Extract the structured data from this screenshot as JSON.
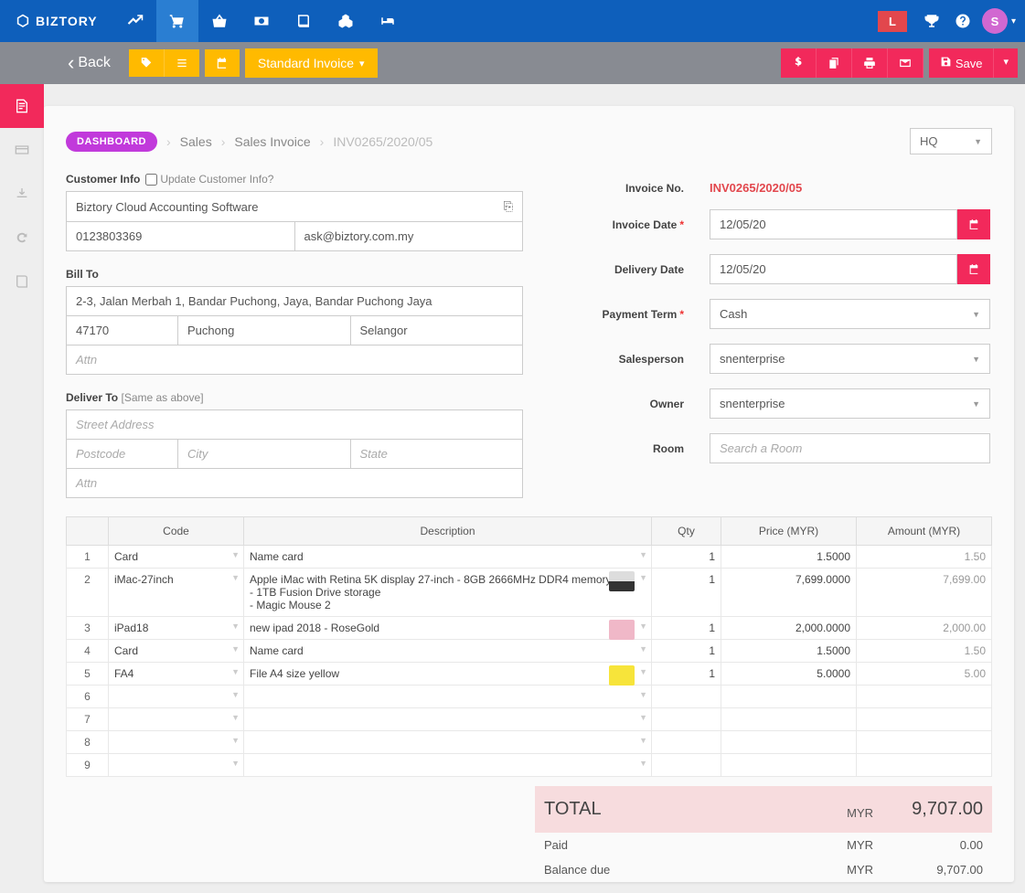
{
  "brand": "BIZTORY",
  "header": {
    "badge": "L",
    "avatar": "S"
  },
  "toolbar": {
    "back": "Back",
    "invoice_type": "Standard Invoice",
    "save": "Save"
  },
  "breadcrumb": {
    "dashboard": "DASHBOARD",
    "sales": "Sales",
    "sales_invoice": "Sales Invoice",
    "current": "INV0265/2020/05",
    "branch": "HQ"
  },
  "customer": {
    "label": "Customer Info",
    "update_label": "Update Customer Info?",
    "name": "Biztory Cloud Accounting Software",
    "phone": "0123803369",
    "email": "ask@biztory.com.my"
  },
  "bill_to": {
    "label": "Bill To",
    "street": "2-3, Jalan Merbah 1, Bandar Puchong, Jaya, Bandar Puchong Jaya",
    "postcode": "47170",
    "city": "Puchong",
    "state": "Selangor",
    "attn_placeholder": "Attn"
  },
  "deliver_to": {
    "label": "Deliver To",
    "sub": "[Same as above]",
    "street_placeholder": "Street Address",
    "postcode_placeholder": "Postcode",
    "city_placeholder": "City",
    "state_placeholder": "State",
    "attn_placeholder": "Attn"
  },
  "invoice": {
    "no_label": "Invoice No.",
    "no_value": "INV0265/2020/05",
    "date_label": "Invoice Date",
    "date_value": "12/05/20",
    "delivery_label": "Delivery Date",
    "delivery_value": "12/05/20",
    "term_label": "Payment Term",
    "term_value": "Cash",
    "sales_label": "Salesperson",
    "sales_value": "snenterprise",
    "owner_label": "Owner",
    "owner_value": "snenterprise",
    "room_label": "Room",
    "room_placeholder": "Search a Room"
  },
  "grid": {
    "headers": {
      "code": "Code",
      "desc": "Description",
      "qty": "Qty",
      "price": "Price (MYR)",
      "amount": "Amount (MYR)"
    },
    "rows": [
      {
        "n": "1",
        "code": "Card",
        "desc": "Name card",
        "qty": "1",
        "price": "1.5000",
        "amount": "1.50",
        "thumb": ""
      },
      {
        "n": "2",
        "code": "iMac-27inch",
        "desc": "Apple iMac with Retina 5K display 27-inch - 8GB 2666MHz DDR4 memory\n- 1TB Fusion Drive storage\n- Magic Mouse 2",
        "qty": "1",
        "price": "7,699.0000",
        "amount": "7,699.00",
        "thumb": "gray"
      },
      {
        "n": "3",
        "code": "iPad18",
        "desc": "new ipad 2018 - RoseGold",
        "qty": "1",
        "price": "2,000.0000",
        "amount": "2,000.00",
        "thumb": "pink"
      },
      {
        "n": "4",
        "code": "Card",
        "desc": "Name card",
        "qty": "1",
        "price": "1.5000",
        "amount": "1.50",
        "thumb": ""
      },
      {
        "n": "5",
        "code": "FA4",
        "desc": "File A4 size yellow",
        "qty": "1",
        "price": "5.0000",
        "amount": "5.00",
        "thumb": "yellow"
      },
      {
        "n": "6",
        "code": "",
        "desc": "",
        "qty": "",
        "price": "",
        "amount": "",
        "thumb": ""
      },
      {
        "n": "7",
        "code": "",
        "desc": "",
        "qty": "",
        "price": "",
        "amount": "",
        "thumb": ""
      },
      {
        "n": "8",
        "code": "",
        "desc": "",
        "qty": "",
        "price": "",
        "amount": "",
        "thumb": ""
      },
      {
        "n": "9",
        "code": "",
        "desc": "",
        "qty": "",
        "price": "",
        "amount": "",
        "thumb": ""
      }
    ]
  },
  "totals": {
    "total_label": "TOTAL",
    "currency": "MYR",
    "total": "9,707.00",
    "paid_label": "Paid",
    "paid": "0.00",
    "balance_label": "Balance due",
    "balance": "9,707.00"
  }
}
